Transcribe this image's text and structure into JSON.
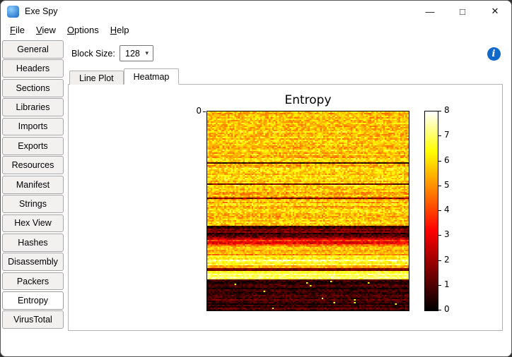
{
  "window": {
    "title": "Exe Spy",
    "controls": {
      "minimize": "—",
      "maximize": "□",
      "close": "✕"
    }
  },
  "menu": {
    "items": [
      {
        "label": "File"
      },
      {
        "label": "View"
      },
      {
        "label": "Options"
      },
      {
        "label": "Help"
      }
    ]
  },
  "sidebar": {
    "items": [
      {
        "label": "General"
      },
      {
        "label": "Headers"
      },
      {
        "label": "Sections"
      },
      {
        "label": "Libraries"
      },
      {
        "label": "Imports"
      },
      {
        "label": "Exports"
      },
      {
        "label": "Resources"
      },
      {
        "label": "Manifest"
      },
      {
        "label": "Strings"
      },
      {
        "label": "Hex View"
      },
      {
        "label": "Hashes"
      },
      {
        "label": "Disassembly"
      },
      {
        "label": "Packers"
      },
      {
        "label": "Entropy",
        "selected": true
      },
      {
        "label": "VirusTotal"
      }
    ]
  },
  "toolbar": {
    "block_size_label": "Block Size:",
    "block_size_value": "128"
  },
  "icons": {
    "chevron_down": "▾",
    "info": "i"
  },
  "tabs": [
    {
      "label": "Line Plot"
    },
    {
      "label": "Heatmap",
      "selected": true
    }
  ],
  "chart_data": {
    "type": "heatmap",
    "title": "Entropy",
    "colormap": "hot",
    "value_range": [
      0,
      8
    ],
    "colorbar_ticks": [
      0,
      1,
      2,
      3,
      4,
      5,
      6,
      7,
      8
    ],
    "y_tick_labels": [
      "0"
    ],
    "grid_size": {
      "cols": 118,
      "rows": 141
    },
    "seed": 42,
    "bands": [
      {
        "from": 0.0,
        "to": 0.575,
        "base": 5.7,
        "row_var": 0.5,
        "cell_var": 0.9,
        "drop_chance": 0.05
      },
      {
        "from": 0.575,
        "to": 0.635,
        "base": 1.1,
        "row_var": 0.9,
        "cell_var": 0.7
      },
      {
        "from": 0.635,
        "to": 0.675,
        "base": 3.4,
        "row_var": 0.9,
        "cell_var": 0.8
      },
      {
        "from": 0.675,
        "to": 0.72,
        "base": 5.2,
        "row_var": 0.6,
        "cell_var": 0.7
      },
      {
        "from": 0.72,
        "to": 0.785,
        "base": 6.3,
        "row_var": 1.1,
        "cell_var": 0.7
      },
      {
        "from": 0.785,
        "to": 0.8,
        "base": 1.6,
        "row_var": 0.7,
        "cell_var": 0.5
      },
      {
        "from": 0.8,
        "to": 0.845,
        "base": 6.9,
        "row_var": 0.4,
        "cell_var": 0.5
      },
      {
        "from": 0.845,
        "to": 1.0,
        "base": 0.7,
        "row_var": 0.6,
        "cell_var": 0.6,
        "spike_chance": 0.004,
        "spike_value": 6.5
      }
    ]
  }
}
